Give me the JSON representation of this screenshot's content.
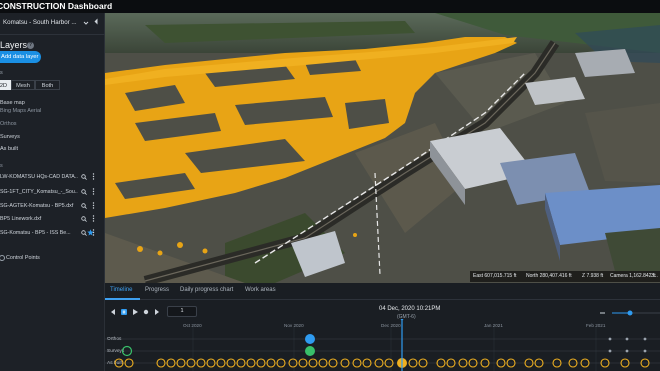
{
  "app": {
    "title": "CONSTRUCTION Dashboard"
  },
  "sidebar": {
    "project_name": "Komatsu - South Harbor ...",
    "layers_title": "Layers",
    "add_data_label": "Add data layer",
    "view_label": "s",
    "view_options": [
      "2D",
      "Mesh",
      "Both"
    ],
    "view_selected": "2D",
    "basemap_title": "Base map",
    "basemap_value": "Bing Maps Aerial",
    "layer_groups": [
      "Orthos",
      "Surveys",
      "As built"
    ],
    "files_header": "s",
    "files": [
      {
        "name": "LW-KOMATSU HQs-CAD DATA...",
        "starred": false
      },
      {
        "name": "SG-1FT_CITY_Komatsu_-_Sou...",
        "starred": false
      },
      {
        "name": "SG-AGTEK-Komatsu - BP5.dxf",
        "starred": false
      },
      {
        "name": "BP5 Linework.dxf",
        "starred": false
      },
      {
        "name": "SG-Komatsu - BP5 - ISS Be...",
        "starred": true
      }
    ],
    "control_points_label": "Control Points"
  },
  "map": {
    "status": {
      "east": "East 607,015.715 ft",
      "north": "North 280,407.416 ft",
      "z": "Z 7.938 ft",
      "camera": "Camera 1,162.842 ft",
      "extra": "3..."
    },
    "colors": {
      "overlay": "#e8a415",
      "terrain_dark": "#4a4a40",
      "building_roof": "#6c8fc8"
    }
  },
  "timeline": {
    "tabs": [
      "Timeline",
      "Progress",
      "Daily progress chart",
      "Work areas"
    ],
    "active_tab": "Timeline",
    "page_value": "1",
    "current_date": "04 Dec, 2020 10:21PM",
    "timezone": "(GMT-6)",
    "months": [
      "Oct 2020",
      "Nov 2020",
      "Dec 2020",
      "Jan 2021",
      "Feb 2021"
    ],
    "row_labels": [
      "Orthos",
      "Surveys",
      "As built"
    ],
    "colors": {
      "accent": "#1a8fe3",
      "ortho": "#2f9bf0",
      "survey": "#39c06a",
      "asbuilt": "#f0b020"
    }
  }
}
